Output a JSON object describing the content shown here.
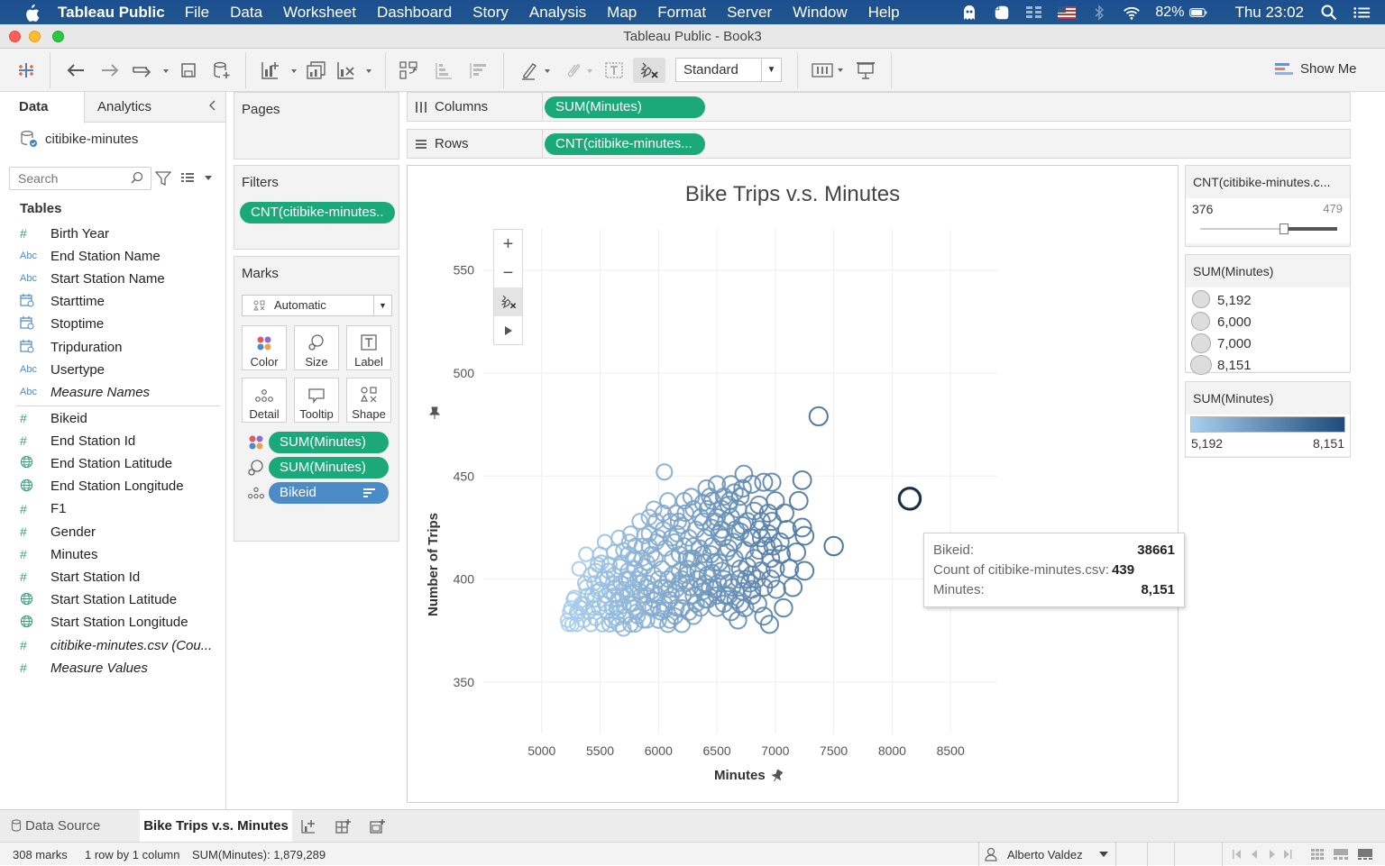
{
  "menubar": {
    "app_name": "Tableau Public",
    "items": [
      "File",
      "Data",
      "Worksheet",
      "Dashboard",
      "Story",
      "Analysis",
      "Map",
      "Format",
      "Server",
      "Window",
      "Help"
    ],
    "battery": "82%",
    "clock": "Thu 23:02"
  },
  "window": {
    "title": "Tableau Public - Book3"
  },
  "toolbar": {
    "fit": "Standard",
    "show_me": "Show Me"
  },
  "datapane": {
    "tab_data": "Data",
    "tab_analytics": "Analytics",
    "datasource": "citibike-minutes",
    "search_placeholder": "Search",
    "tables_heading": "Tables",
    "dimensions": [
      {
        "icon": "#",
        "type": "measure",
        "name": "Birth Year"
      },
      {
        "icon": "Abc",
        "type": "string",
        "name": "End Station Name"
      },
      {
        "icon": "Abc",
        "type": "string",
        "name": "Start Station Name"
      },
      {
        "icon": "cal",
        "type": "date",
        "name": "Starttime"
      },
      {
        "icon": "cal",
        "type": "date",
        "name": "Stoptime"
      },
      {
        "icon": "cal",
        "type": "date",
        "name": "Tripduration"
      },
      {
        "icon": "Abc",
        "type": "string",
        "name": "Usertype"
      },
      {
        "icon": "Abc",
        "type": "string",
        "name": "Measure Names",
        "italic": true
      }
    ],
    "measures": [
      {
        "icon": "#",
        "type": "measure",
        "name": "Bikeid"
      },
      {
        "icon": "#",
        "type": "measure",
        "name": "End Station Id"
      },
      {
        "icon": "geo",
        "type": "geo",
        "name": "End Station Latitude"
      },
      {
        "icon": "geo",
        "type": "geo",
        "name": "End Station Longitude"
      },
      {
        "icon": "#",
        "type": "measure",
        "name": "F1"
      },
      {
        "icon": "#",
        "type": "measure",
        "name": "Gender"
      },
      {
        "icon": "#",
        "type": "measure",
        "name": "Minutes"
      },
      {
        "icon": "#",
        "type": "measure",
        "name": "Start Station Id"
      },
      {
        "icon": "geo",
        "type": "geo",
        "name": "Start Station Latitude"
      },
      {
        "icon": "geo",
        "type": "geo",
        "name": "Start Station Longitude"
      },
      {
        "icon": "#",
        "type": "measure",
        "name": "citibike-minutes.csv (Cou...",
        "italic": true
      },
      {
        "icon": "#",
        "type": "measure",
        "name": "Measure Values",
        "italic": true
      }
    ]
  },
  "pages": {
    "title": "Pages"
  },
  "filters": {
    "title": "Filters",
    "pill": "CNT(citibike-minutes.."
  },
  "marks": {
    "title": "Marks",
    "type": "Automatic",
    "buttons": [
      "Color",
      "Size",
      "Label",
      "Detail",
      "Tooltip",
      "Shape"
    ],
    "pills": [
      "SUM(Minutes)",
      "SUM(Minutes)",
      "Bikeid"
    ]
  },
  "shelves": {
    "columns_label": "Columns",
    "columns_pill": "SUM(Minutes)",
    "rows_label": "Rows",
    "rows_pill": "CNT(citibike-minutes..."
  },
  "legends": {
    "filter_title": "CNT(citibike-minutes.c...",
    "filter_min": "376",
    "filter_max": "479",
    "filter_value_fraction": 0.61,
    "size_title": "SUM(Minutes)",
    "size_items": [
      "5,192",
      "6,000",
      "7,000",
      "8,151"
    ],
    "color_title": "SUM(Minutes)",
    "color_min": "5,192",
    "color_max": "8,151",
    "color_from": "#a9cfee",
    "color_to": "#1f4a7a"
  },
  "tooltip": {
    "k1": "Bikeid:",
    "v1": "38661",
    "k2": "Count of citibike-minutes.csv:",
    "v2": "439",
    "k3": "Minutes:",
    "v3": "8,151"
  },
  "chart_data": {
    "type": "scatter",
    "title": "Bike Trips v.s. Minutes",
    "xlabel": "Minutes",
    "ylabel": "Number of Trips",
    "xlim": [
      4500,
      8900
    ],
    "ylim": [
      325,
      570
    ],
    "x_ticks": [
      5000,
      5500,
      6000,
      6500,
      7000,
      7500,
      8000,
      8500
    ],
    "y_ticks": [
      350,
      400,
      450,
      500,
      550
    ],
    "grid": true,
    "highlighted_point": {
      "x": 8151,
      "y": 439
    },
    "points": [
      [
        7370,
        479
      ],
      [
        8151,
        439
      ],
      [
        7500,
        416
      ],
      [
        6050,
        452
      ],
      [
        7230,
        448
      ],
      [
        7200,
        438
      ],
      [
        6970,
        447
      ],
      [
        6900,
        447
      ],
      [
        6730,
        451
      ],
      [
        6650,
        442
      ],
      [
        6800,
        446
      ],
      [
        6700,
        440
      ],
      [
        7230,
        425
      ],
      [
        7250,
        421
      ],
      [
        7180,
        413
      ],
      [
        7250,
        404
      ],
      [
        7150,
        396
      ],
      [
        7070,
        386
      ],
      [
        7100,
        424
      ],
      [
        6980,
        416
      ],
      [
        6970,
        428
      ],
      [
        7080,
        432
      ],
      [
        6860,
        436
      ],
      [
        6720,
        444
      ],
      [
        6610,
        438
      ],
      [
        6500,
        446
      ],
      [
        6410,
        444
      ],
      [
        6380,
        437
      ],
      [
        6220,
        438
      ],
      [
        6150,
        432
      ],
      [
        5920,
        430
      ],
      [
        5880,
        421
      ],
      [
        5750,
        418
      ],
      [
        5780,
        410
      ],
      [
        5620,
        413
      ],
      [
        5580,
        407
      ],
      [
        5480,
        407
      ],
      [
        5420,
        402
      ],
      [
        5380,
        396
      ],
      [
        5360,
        388
      ],
      [
        5300,
        378
      ],
      [
        5230,
        378
      ],
      [
        5310,
        383
      ],
      [
        5250,
        386
      ],
      [
        5450,
        390
      ],
      [
        5500,
        395
      ],
      [
        5560,
        400
      ],
      [
        5600,
        386
      ],
      [
        5650,
        390
      ],
      [
        5700,
        395
      ],
      [
        5750,
        400
      ],
      [
        5800,
        405
      ],
      [
        5850,
        398
      ],
      [
        5900,
        392
      ],
      [
        5950,
        386
      ],
      [
        6000,
        380
      ],
      [
        6050,
        385
      ],
      [
        6100,
        390
      ],
      [
        6150,
        395
      ],
      [
        6200,
        400
      ],
      [
        6250,
        405
      ],
      [
        6300,
        410
      ],
      [
        6350,
        415
      ],
      [
        6400,
        420
      ],
      [
        6450,
        425
      ],
      [
        6500,
        430
      ],
      [
        6550,
        420
      ],
      [
        6600,
        415
      ],
      [
        6650,
        410
      ],
      [
        6700,
        405
      ],
      [
        6750,
        400
      ],
      [
        6800,
        395
      ],
      [
        6850,
        388
      ],
      [
        6900,
        382
      ],
      [
        6950,
        378
      ],
      [
        6560,
        400
      ],
      [
        6480,
        395
      ],
      [
        6420,
        390
      ],
      [
        6360,
        386
      ],
      [
        6300,
        392
      ],
      [
        6240,
        398
      ],
      [
        6180,
        404
      ],
      [
        6120,
        410
      ],
      [
        6060,
        415
      ],
      [
        6000,
        420
      ],
      [
        5940,
        412
      ],
      [
        5880,
        406
      ],
      [
        5820,
        400
      ],
      [
        5760,
        393
      ],
      [
        5700,
        387
      ],
      [
        5640,
        381
      ],
      [
        5580,
        378
      ],
      [
        5520,
        378
      ],
      [
        5460,
        381
      ],
      [
        5400,
        384
      ],
      [
        5340,
        388
      ],
      [
        5280,
        391
      ],
      [
        5220,
        380
      ],
      [
        5560,
        384
      ],
      [
        5620,
        392
      ],
      [
        5680,
        398
      ],
      [
        5740,
        404
      ],
      [
        5800,
        410
      ],
      [
        5860,
        416
      ],
      [
        5920,
        422
      ],
      [
        5980,
        428
      ],
      [
        6040,
        432
      ],
      [
        6100,
        428
      ],
      [
        6160,
        422
      ],
      [
        6220,
        416
      ],
      [
        6280,
        410
      ],
      [
        6340,
        404
      ],
      [
        6400,
        398
      ],
      [
        6460,
        403
      ],
      [
        6520,
        408
      ],
      [
        6580,
        413
      ],
      [
        6640,
        418
      ],
      [
        6700,
        423
      ],
      [
        6760,
        428
      ],
      [
        6820,
        433
      ],
      [
        6880,
        428
      ],
      [
        6940,
        422
      ],
      [
        6860,
        414
      ],
      [
        6790,
        420
      ],
      [
        6720,
        426
      ],
      [
        6620,
        430
      ],
      [
        6540,
        434
      ],
      [
        6460,
        438
      ],
      [
        6380,
        428
      ],
      [
        6320,
        424
      ],
      [
        6260,
        420
      ],
      [
        6200,
        426
      ],
      [
        6140,
        418
      ],
      [
        6080,
        400
      ],
      [
        6020,
        396
      ],
      [
        5960,
        402
      ],
      [
        5900,
        408
      ],
      [
        5840,
        394
      ],
      [
        5780,
        388
      ],
      [
        5720,
        382
      ],
      [
        5660,
        378
      ],
      [
        5600,
        380
      ],
      [
        5540,
        388
      ],
      [
        5480,
        394
      ],
      [
        5420,
        378
      ],
      [
        5360,
        380
      ],
      [
        5300,
        384
      ],
      [
        5260,
        378
      ],
      [
        5700,
        376
      ],
      [
        5800,
        378
      ],
      [
        5900,
        380
      ],
      [
        6000,
        386
      ],
      [
        6100,
        380
      ],
      [
        6200,
        386
      ],
      [
        6300,
        382
      ],
      [
        6400,
        390
      ],
      [
        6500,
        386
      ],
      [
        6600,
        392
      ],
      [
        6700,
        388
      ],
      [
        6800,
        392
      ],
      [
        6900,
        396
      ],
      [
        7000,
        405
      ],
      [
        7050,
        412
      ],
      [
        7120,
        405
      ],
      [
        7010,
        395
      ],
      [
        6960,
        400
      ],
      [
        6880,
        404
      ],
      [
        6820,
        410
      ],
      [
        6760,
        406
      ],
      [
        6690,
        400
      ],
      [
        6630,
        396
      ],
      [
        6570,
        392
      ],
      [
        6510,
        398
      ],
      [
        6450,
        412
      ],
      [
        6390,
        408
      ],
      [
        6330,
        400
      ],
      [
        6270,
        396
      ],
      [
        6210,
        392
      ],
      [
        6150,
        386
      ],
      [
        6090,
        395
      ],
      [
        6030,
        405
      ],
      [
        5970,
        410
      ],
      [
        5910,
        398
      ],
      [
        5850,
        392
      ],
      [
        5790,
        386
      ],
      [
        5730,
        392
      ],
      [
        5670,
        406
      ],
      [
        5610,
        398
      ],
      [
        5550,
        392
      ],
      [
        5490,
        386
      ],
      [
        5430,
        392
      ],
      [
        5370,
        398
      ],
      [
        5320,
        405
      ],
      [
        5500,
        412
      ],
      [
        5540,
        418
      ],
      [
        5660,
        420
      ],
      [
        5700,
        414
      ],
      [
        5760,
        422
      ],
      [
        5840,
        428
      ],
      [
        5960,
        434
      ],
      [
        6080,
        438
      ],
      [
        6280,
        440
      ],
      [
        6440,
        440
      ],
      [
        6600,
        436
      ],
      [
        6580,
        428
      ],
      [
        6520,
        422
      ],
      [
        6460,
        416
      ],
      [
        6380,
        412
      ],
      [
        6300,
        416
      ],
      [
        6240,
        410
      ],
      [
        6180,
        412
      ],
      [
        6120,
        402
      ],
      [
        6060,
        396
      ],
      [
        6000,
        400
      ],
      [
        5940,
        394
      ],
      [
        5880,
        388
      ],
      [
        5820,
        382
      ],
      [
        5760,
        378
      ],
      [
        5640,
        386
      ],
      [
        5580,
        394
      ],
      [
        5520,
        400
      ],
      [
        5460,
        404
      ],
      [
        5380,
        412
      ],
      [
        5620,
        402
      ],
      [
        5680,
        408
      ],
      [
        5740,
        412
      ],
      [
        5800,
        416
      ],
      [
        5860,
        410
      ],
      [
        5920,
        416
      ],
      [
        5980,
        418
      ],
      [
        6040,
        424
      ],
      [
        6110,
        420
      ],
      [
        6170,
        428
      ],
      [
        6230,
        432
      ],
      [
        6300,
        434
      ],
      [
        6360,
        430
      ],
      [
        6420,
        434
      ],
      [
        6480,
        428
      ],
      [
        6540,
        424
      ],
      [
        6660,
        424
      ],
      [
        6740,
        414
      ],
      [
        6800,
        420
      ],
      [
        6860,
        424
      ],
      [
        6920,
        416
      ],
      [
        6960,
        410
      ],
      [
        7040,
        418
      ],
      [
        6840,
        400
      ],
      [
        6780,
        398
      ],
      [
        6720,
        394
      ],
      [
        6660,
        390
      ],
      [
        6600,
        398
      ],
      [
        6540,
        404
      ],
      [
        6480,
        408
      ],
      [
        6420,
        402
      ],
      [
        6360,
        396
      ],
      [
        6240,
        402
      ],
      [
        6180,
        398
      ],
      [
        6110,
        392
      ],
      [
        6050,
        388
      ],
      [
        5990,
        392
      ],
      [
        5930,
        386
      ],
      [
        5870,
        380
      ],
      [
        5810,
        384
      ],
      [
        5750,
        388
      ],
      [
        5690,
        392
      ],
      [
        5630,
        396
      ],
      [
        5570,
        404
      ],
      [
        5510,
        408
      ],
      [
        5450,
        398
      ],
      [
        5390,
        392
      ],
      [
        5330,
        386
      ],
      [
        5270,
        390
      ],
      [
        5240,
        384
      ],
      [
        5440,
        386
      ],
      [
        5660,
        384
      ],
      [
        5720,
        400
      ],
      [
        5780,
        396
      ],
      [
        5840,
        402
      ],
      [
        5900,
        396
      ],
      [
        5960,
        390
      ],
      [
        6020,
        384
      ],
      [
        6080,
        378
      ],
      [
        6140,
        382
      ],
      [
        6200,
        378
      ],
      [
        6260,
        384
      ],
      [
        6320,
        388
      ],
      [
        6380,
        394
      ],
      [
        6440,
        396
      ],
      [
        6500,
        392
      ],
      [
        6560,
        388
      ],
      [
        6620,
        384
      ],
      [
        6680,
        380
      ],
      [
        6740,
        386
      ],
      [
        6800,
        402
      ],
      [
        6880,
        420
      ],
      [
        6940,
        432
      ],
      [
        7000,
        438
      ],
      [
        6620,
        446
      ],
      [
        6560,
        440
      ],
      [
        6680,
        434
      ]
    ]
  },
  "sheettabs": {
    "datasource": "Data Source",
    "active": "Bike Trips v.s. Minutes"
  },
  "statusbar": {
    "marks": "308 marks",
    "dims": "1 row by 1 column",
    "sum": "SUM(Minutes): 1,879,289",
    "user": "Alberto Valdez"
  }
}
